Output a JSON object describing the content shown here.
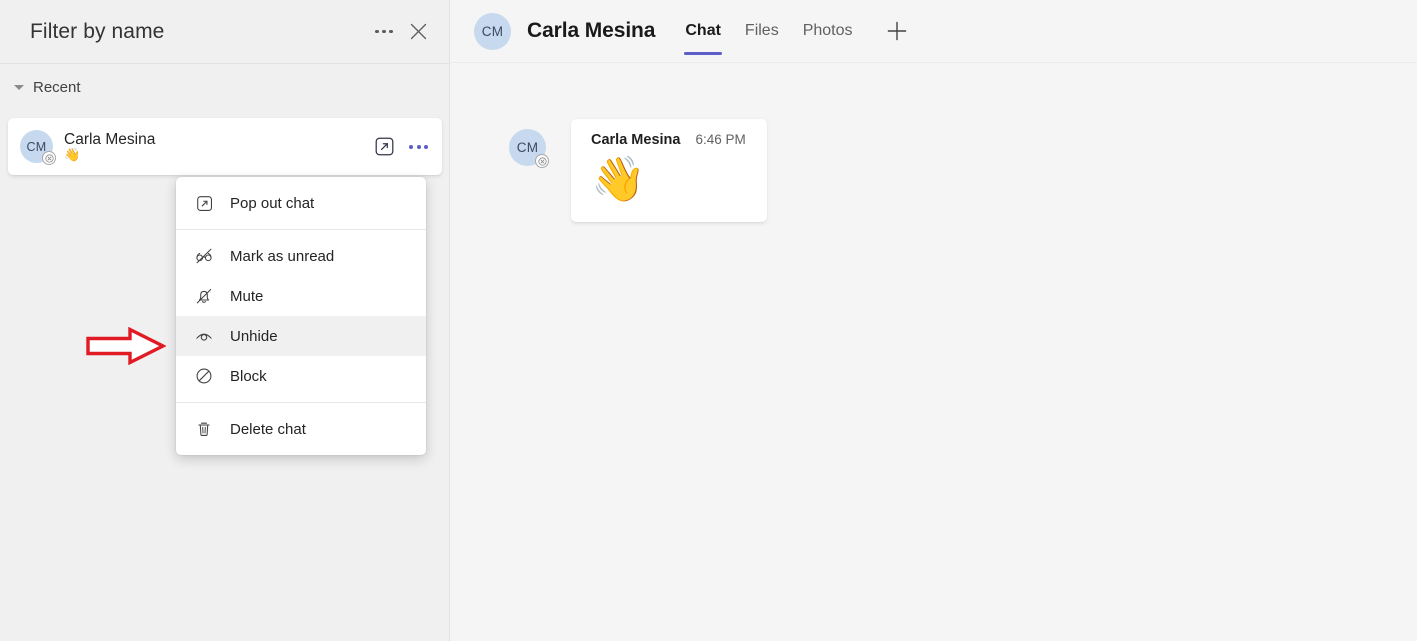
{
  "left_panel": {
    "header": {
      "title": "Filter by name",
      "more_icon": "more-horizontal-icon",
      "close_icon": "close-icon"
    },
    "section": {
      "label": "Recent",
      "caret_icon": "chevron-down-icon"
    },
    "chat_item": {
      "avatar_initials": "CM",
      "name": "Carla Mesina",
      "preview_emoji": "👋",
      "status": "blocked",
      "popout_icon": "pop-out-icon",
      "more_icon": "more-horizontal-icon"
    }
  },
  "context_menu": {
    "groups": [
      {
        "items": [
          {
            "label": "Pop out chat",
            "icon": "pop-out-icon",
            "selected": false
          }
        ]
      },
      {
        "items": [
          {
            "label": "Mark as unread",
            "icon": "mark-as-unread-icon",
            "selected": false
          },
          {
            "label": "Mute",
            "icon": "bell-mute-icon",
            "selected": false
          },
          {
            "label": "Unhide",
            "icon": "eye-icon",
            "selected": true
          },
          {
            "label": "Block",
            "icon": "block-icon",
            "selected": false
          }
        ]
      },
      {
        "items": [
          {
            "label": "Delete chat",
            "icon": "trash-icon",
            "selected": false
          }
        ]
      }
    ]
  },
  "annotation": {
    "arrow_color": "#e01b24",
    "arrow_direction": "right",
    "points_at": "Unhide"
  },
  "right_panel": {
    "header": {
      "avatar_initials": "CM",
      "peer_name": "Carla Mesina",
      "tabs": [
        {
          "label": "Chat",
          "active": true
        },
        {
          "label": "Files",
          "active": false
        },
        {
          "label": "Photos",
          "active": false
        }
      ],
      "add_tab_icon": "plus-icon",
      "active_tab_color": "#5b5fc7"
    },
    "message": {
      "avatar_initials": "CM",
      "author": "Carla Mesina",
      "time": "6:46 PM",
      "content_emoji": "👋",
      "status": "blocked"
    }
  }
}
